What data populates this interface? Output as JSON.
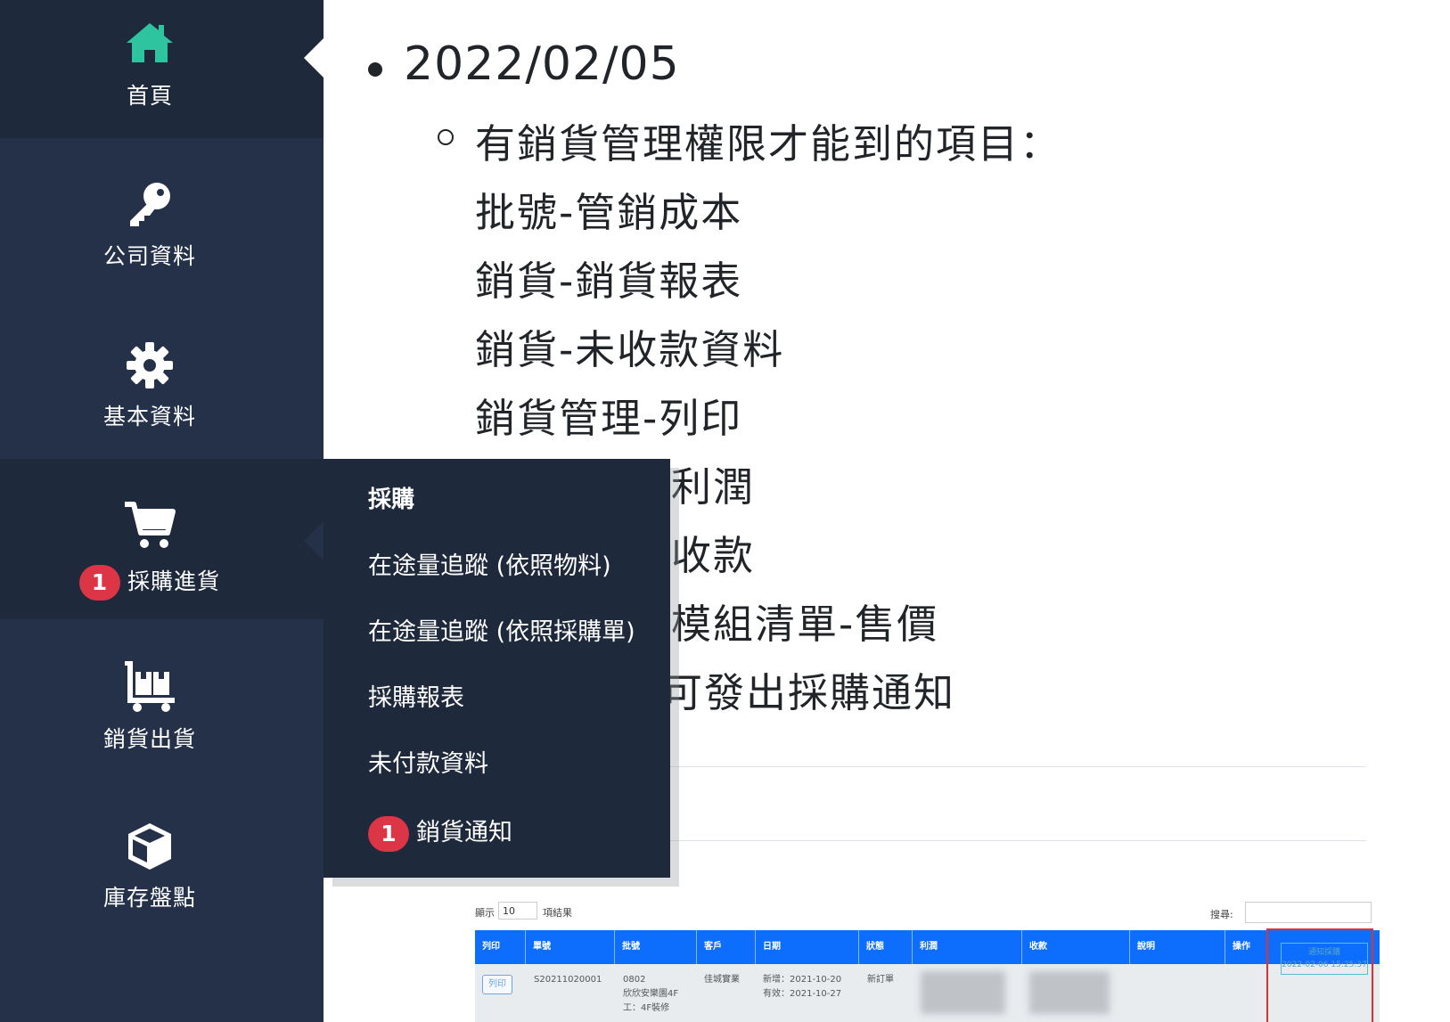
{
  "sidebar": {
    "items": [
      {
        "label": "首頁",
        "icon": "home-icon"
      },
      {
        "label": "公司資料",
        "icon": "key-icon"
      },
      {
        "label": "基本資料",
        "icon": "gear-icon"
      },
      {
        "label": "採購進貨",
        "icon": "cart-icon",
        "badge": "1"
      },
      {
        "label": "銷貨出貨",
        "icon": "dolly-icon"
      },
      {
        "label": "庫存盤點",
        "icon": "box-icon"
      }
    ]
  },
  "dropdown": {
    "heading": "採購",
    "items": [
      {
        "label": "在途量追蹤 (依照物料)"
      },
      {
        "label": "在途量追蹤 (依照採購單)"
      },
      {
        "label": "採購報表"
      },
      {
        "label": "未付款資料"
      },
      {
        "label": "銷貨通知",
        "badge": "1"
      }
    ]
  },
  "content": {
    "date": "2022/02/05",
    "lines": [
      "有銷貨管理權限才能到的項目：",
      "批號-管銷成本",
      "銷貨-銷貨報表",
      "銷貨-未收款資料",
      "銷貨管理-列印",
      "利潤",
      "收款",
      "模組清單-售價",
      "可發出採購通知"
    ]
  },
  "screenshot": {
    "show_label": "顯示",
    "page_size": "10",
    "results_label": "項結果",
    "search_label": "搜尋:",
    "columns": [
      "列印",
      "單號",
      "批號",
      "客戶",
      "日期",
      "狀態",
      "利潤",
      "收款",
      "說明",
      "操作"
    ],
    "row": {
      "print": "列印",
      "order_no": "S20211020001",
      "batch": [
        "0802",
        "欣欣安樂園4F",
        "工：4F裝修"
      ],
      "customer": "佳城實業",
      "dates": [
        "新增：2021-10-20",
        "有效：2021-10-27"
      ],
      "status": "新訂單",
      "op_label": "通知採購",
      "op_time": "2022-02-06 15:25:37"
    }
  },
  "colors": {
    "sidebar_bg": "#243148",
    "sidebar_active": "#1e293b",
    "home_icon": "#2ec4a0",
    "badge": "#dc3545",
    "table_header": "#0d6efd"
  }
}
